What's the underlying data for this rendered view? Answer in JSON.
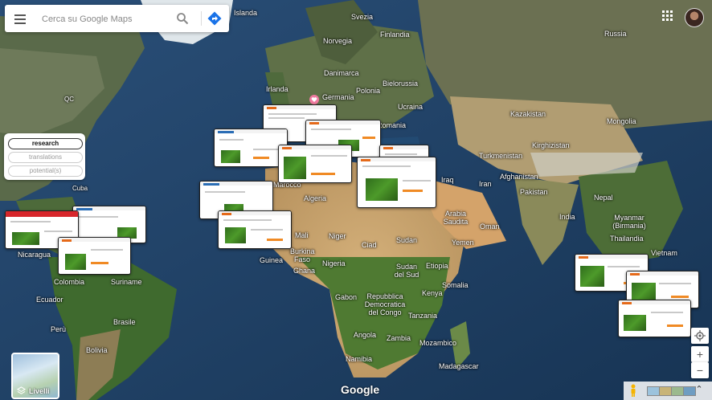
{
  "search": {
    "placeholder": "Cerca su Google Maps"
  },
  "icons": {
    "menu": "hamburger-menu-icon",
    "search": "magnifier-icon",
    "directions": "directions-arrow-icon",
    "apps": "apps-grid-icon",
    "layers": "layers-icon",
    "pegman": "pegman-icon",
    "my_location": "location-target-icon",
    "zoom_in": "plus-icon",
    "zoom_out": "minus-icon",
    "expand": "chevron-up-icon",
    "pin": "heart-pin-icon"
  },
  "colors": {
    "ocean": "#1f3f63",
    "directions_blue": "#1a73e8",
    "result_accent": "#e56a1a"
  },
  "filter_panel": {
    "items": [
      {
        "label": "research",
        "active": true
      },
      {
        "label": "translations",
        "active": false
      },
      {
        "label": "potential(s)",
        "active": false
      }
    ]
  },
  "map_labels": [
    "Islanda",
    "Svezia",
    "Finlandia",
    "Russia",
    "Norvegia",
    "Danimarca",
    "Irlanda",
    "Polonia",
    "Bielorussia",
    "Germania",
    "Ucraina",
    "Kazakistan",
    "Romania",
    "Mongolia",
    "Kirghizistan",
    "Turkmenistan",
    "Afghanistan",
    "Iraq",
    "Iran",
    "Pakistan",
    "Nepal",
    "Marocco",
    "Algeria",
    "Arabia Saudita",
    "India",
    "Myanmar (Birmania)",
    "Thailandia",
    "Yemen",
    "Oman",
    "Mali",
    "Niger",
    "Ciad",
    "Sudan",
    "Vietnam",
    "Nicaragua",
    "Guinea",
    "Burkina Faso",
    "Nigeria",
    "Sudan del Sud",
    "Etiopia",
    "Colombia",
    "Suriname",
    "Ghana",
    "Somalia",
    "Ecuador",
    "Gabon",
    "Repubblica Democratica del Congo",
    "Kenya",
    "Perù",
    "Brasile",
    "Tanzania",
    "Bolivia",
    "Angola",
    "Zambia",
    "Mozambico",
    "Namibia",
    "Madagascar",
    "QC",
    "Cuba"
  ],
  "result_thumbnails": [
    {
      "title": "result-1"
    },
    {
      "title": "result-2"
    },
    {
      "title": "result-3"
    },
    {
      "title": "result-4"
    },
    {
      "title": "result-5"
    },
    {
      "title": "result-6"
    },
    {
      "title": "result-7"
    },
    {
      "title": "result-8"
    },
    {
      "title": "result-9"
    },
    {
      "title": "result-10"
    },
    {
      "title": "result-11"
    },
    {
      "title": "result-12"
    },
    {
      "title": "result-13"
    }
  ],
  "layers_button": {
    "label": "Livelli"
  },
  "attribution": {
    "brand": "Google"
  }
}
